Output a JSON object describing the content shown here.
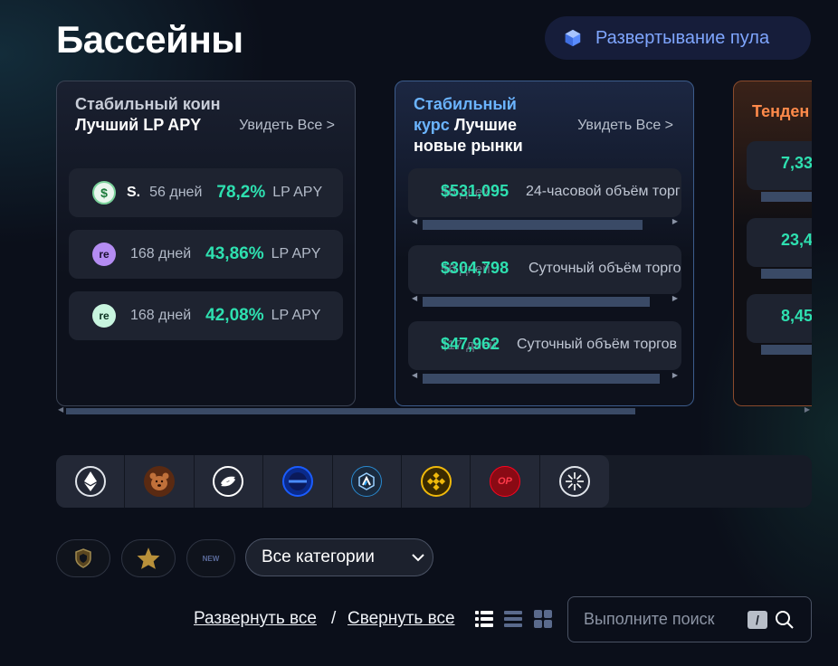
{
  "page": {
    "title": "Бассейны"
  },
  "header": {
    "deploy_label": "Развертывание пула",
    "deploy_icon": "cube-icon"
  },
  "cards": [
    {
      "title_muted": "Стабильный коин",
      "title_bold": "Лучший LP APY",
      "see_all": "Увидеть Все >",
      "rows": [
        {
          "icon": "dollar-coin-icon",
          "ticker": "S.",
          "days": "56 дней",
          "apy": "78,2%",
          "apy_label": "LP APY"
        },
        {
          "icon": "re-token-icon",
          "ticker": "",
          "days": "168 дней",
          "apy": "43,86%",
          "apy_label": "LP APY"
        },
        {
          "icon": "re-token-icon",
          "ticker": "",
          "days": "168 дней",
          "apy": "42,08%",
          "apy_label": "LP APY"
        }
      ]
    },
    {
      "title_colored": "Стабильный курс",
      "title_bold": "Лучшие новые рынки",
      "see_all": "Увидеть Все >",
      "rows": [
        {
          "days": "56 дней",
          "volume": "$531,095",
          "label": "24-часовой объём торг"
        },
        {
          "days": "56 дней",
          "volume": "$304,798",
          "label": "Суточный объём торго"
        },
        {
          "days": "117 дней",
          "volume": "$47,962",
          "label": "Суточный объём торгов"
        }
      ]
    },
    {
      "title_colored": "Тенден",
      "rows": [
        {
          "value": "7,33"
        },
        {
          "value": "23,4"
        },
        {
          "value": "8,45"
        }
      ]
    }
  ],
  "chains": [
    {
      "name": "ethereum-icon",
      "color": "#ffffff"
    },
    {
      "name": "bear-icon",
      "color": "#7a3a1a"
    },
    {
      "name": "arrow-swirl-icon",
      "color": "#ffffff"
    },
    {
      "name": "base-icon",
      "color": "#1a5cff"
    },
    {
      "name": "arbitrum-icon",
      "color": "#2a8ad0"
    },
    {
      "name": "bnb-icon",
      "color": "#f0b90b"
    },
    {
      "name": "optimism-icon",
      "color": "#ff0420"
    },
    {
      "name": "sunburst-icon",
      "color": "#ffffff"
    }
  ],
  "filters": {
    "shield_icon": "shield-icon",
    "star_icon": "star-icon",
    "new_badge": "NEW",
    "category_label": "Все категории"
  },
  "bottom": {
    "expand_all": "Развернуть все",
    "separator": "/",
    "collapse_all": "Свернуть все",
    "search_placeholder": "Выполните поиск",
    "search_shortcut": "/"
  }
}
